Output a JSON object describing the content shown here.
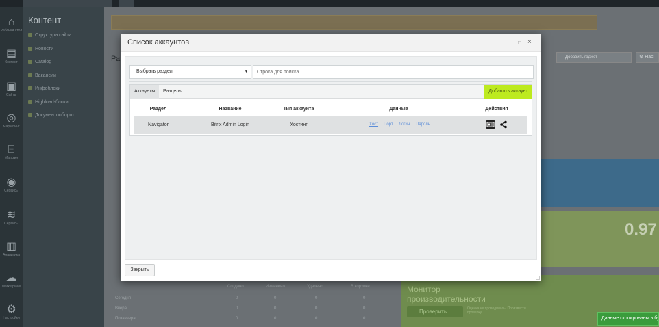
{
  "sidebar": {
    "title": "Контент",
    "items": [
      {
        "label": "Структура сайта"
      },
      {
        "label": "Новости"
      },
      {
        "label": "Catalog"
      },
      {
        "label": "Вакансии"
      },
      {
        "label": "Инфоблоки"
      },
      {
        "label": "Highload-блоки"
      },
      {
        "label": "Документооборот"
      }
    ]
  },
  "nav": {
    "items": [
      {
        "icon": "home-icon",
        "glyph": "⌂",
        "label": "Рабочий стол"
      },
      {
        "icon": "content-icon",
        "glyph": "▤",
        "label": "Контент"
      },
      {
        "icon": "sites-icon",
        "glyph": "▣",
        "label": "Сайты"
      },
      {
        "icon": "marketing-icon",
        "glyph": "◎",
        "label": "Маркетинг"
      },
      {
        "icon": "shop-icon",
        "glyph": "⌸",
        "label": "Магазин"
      },
      {
        "icon": "services-icon",
        "glyph": "◉",
        "label": "Сервисы"
      },
      {
        "icon": "layers-icon",
        "glyph": "≋",
        "label": "Сервисы"
      },
      {
        "icon": "analytics-icon",
        "glyph": "▥",
        "label": "Аналитика"
      },
      {
        "icon": "cloud-icon",
        "glyph": "☁",
        "label": "Marketplace"
      },
      {
        "icon": "settings-icon",
        "glyph": "⚙",
        "label": "Настройки"
      }
    ]
  },
  "background": {
    "page_title": "Ра",
    "gadget_button": "Добавить гаджет",
    "gear_label": "Нас",
    "big_number": "0.97",
    "perf_title": "Монитор производительности",
    "perf_button": "Проверить",
    "perf_note": "Оценка не проводилась. Произвести проверку",
    "table_headers": [
      "Сегодня",
      "Вчера",
      "Позавчера"
    ],
    "table_cols": [
      "Создано",
      "Изменено",
      "Удалено",
      "В корзине"
    ],
    "table_value": "0"
  },
  "modal": {
    "title": "Список аккаунтов",
    "section_select": "Выбрать раздел",
    "search_placeholder": "Строка для поиска",
    "tabs": [
      {
        "label": "Аккаунты",
        "active": true
      },
      {
        "label": "Разделы",
        "active": false
      }
    ],
    "add_button": "Добавить аккаунт",
    "columns": {
      "section": "Раздел",
      "name": "Название",
      "type": "Тип аккаунта",
      "data": "Данные",
      "actions": "Действия"
    },
    "rows": [
      {
        "section": "Navigator",
        "name": "Bitrix Admin Login",
        "type": "Хостинг",
        "links": [
          "Хост",
          "Порт",
          "Логин",
          "Пароль"
        ]
      }
    ],
    "close_button": "Закрыть"
  },
  "toast": {
    "text": "Данные скопированы в буфер"
  },
  "colors": {
    "accent_green": "#bdea1f",
    "link_blue": "#5d8ed8",
    "toast_green": "#3a9c3c"
  }
}
